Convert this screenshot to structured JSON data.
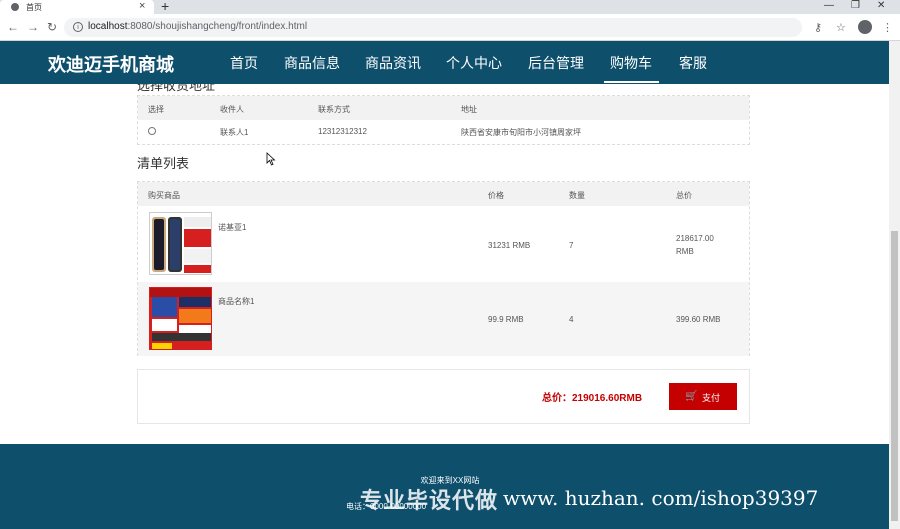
{
  "browser": {
    "tab_title": "首页",
    "url_host": "localhost",
    "url_path": ":8080/shoujishangcheng/front/index.html"
  },
  "site": {
    "brand": "欢迪迈手机商城",
    "menu": [
      "首页",
      "商品信息",
      "商品资讯",
      "个人中心",
      "后台管理",
      "购物车",
      "客服"
    ],
    "active_menu": "购物车"
  },
  "address_section": {
    "title": "选择收货地址",
    "headers": [
      "选择",
      "收件人",
      "联系方式",
      "地址"
    ],
    "rows": [
      {
        "recipient": "联系人1",
        "phone": "12312312312",
        "address": "陕西省安康市旬阳市小河镇周家坪"
      }
    ]
  },
  "list_section": {
    "title": "清单列表",
    "headers": [
      "购买商品",
      "价格",
      "数量",
      "总价"
    ],
    "rows": [
      {
        "name": "诺基亚1",
        "price": "31231 RMB",
        "qty": "7",
        "total_line1": "218617.00",
        "total_line2": "RMB"
      },
      {
        "name": "商品名称1",
        "price": "99.9 RMB",
        "qty": "4",
        "total_line1": "399.60 RMB",
        "total_line2": ""
      }
    ]
  },
  "payment": {
    "total_label": "总价：219016.60RMB",
    "pay_button": "支付"
  },
  "footer": {
    "welcome": "欢迎来到XX网站",
    "contact": "电话：0000-00000000"
  },
  "watermark": {
    "cn": "专业毕设代做",
    "url": "www. huzhan. com/ishop39397"
  },
  "colors": {
    "header_bg": "#0e4f6c",
    "accent_red": "#c40000"
  }
}
